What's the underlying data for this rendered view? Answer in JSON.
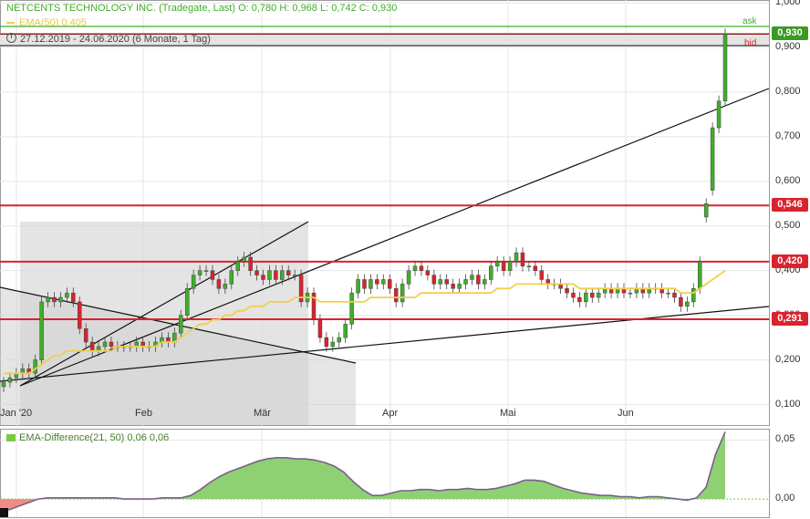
{
  "header": {
    "title": "NETCENTS TECHNOLOGY INC. (Tradegate, Last)  O: 0,780  H: 0,968  L: 0,742  C: 0,930",
    "ema_legend": "EMA(50)  0,405",
    "date_range": "27.12.2019 - 24.06.2020   (6 Monate, 1 Tag)"
  },
  "tags": {
    "ask": "ask",
    "bid": "bid"
  },
  "price_badges": [
    {
      "label": "0,930",
      "value": 0.93,
      "color": "#3a9a23"
    },
    {
      "label": "0,546",
      "value": 0.546,
      "color": "#d9232e"
    },
    {
      "label": "0,420",
      "value": 0.42,
      "color": "#d9232e"
    },
    {
      "label": "0,291",
      "value": 0.291,
      "color": "#d9232e"
    }
  ],
  "colors": {
    "up": "#3fae29",
    "down": "#d9232e",
    "ema": "#f0cf4a",
    "hline": "#d9232e",
    "area": "#8ed172",
    "area_neg": "#f08b86"
  },
  "subpanel": {
    "legend": "EMA-Difference(21, 50)  0,06   0,06"
  },
  "chart_data": [
    {
      "type": "candlestick",
      "title": "NETCENTS TECHNOLOGY INC. (Tradegate, Last)",
      "x_labels": [
        "Jan '20",
        "Feb",
        "Mär",
        "Apr",
        "Mai",
        "Jun"
      ],
      "y_ticks": [
        "1,000",
        "0,900",
        "0,800",
        "0,700",
        "0,600",
        "0,500",
        "0,400",
        "0,300",
        "0,200",
        "0,100"
      ],
      "y_tick_values": [
        1.0,
        0.9,
        0.8,
        0.7,
        0.6,
        0.5,
        0.4,
        0.3,
        0.2,
        0.1
      ],
      "ylim": [
        0.05,
        1.0
      ],
      "grid": true,
      "ohlc_close": [
        0.15,
        0.16,
        0.17,
        0.18,
        0.17,
        0.2,
        0.33,
        0.34,
        0.33,
        0.34,
        0.35,
        0.33,
        0.27,
        0.24,
        0.22,
        0.23,
        0.24,
        0.23,
        0.23,
        0.23,
        0.23,
        0.24,
        0.23,
        0.23,
        0.24,
        0.25,
        0.24,
        0.26,
        0.3,
        0.36,
        0.39,
        0.4,
        0.4,
        0.38,
        0.36,
        0.37,
        0.4,
        0.42,
        0.43,
        0.4,
        0.39,
        0.38,
        0.4,
        0.38,
        0.4,
        0.39,
        0.39,
        0.33,
        0.35,
        0.29,
        0.25,
        0.23,
        0.24,
        0.25,
        0.28,
        0.35,
        0.38,
        0.36,
        0.38,
        0.37,
        0.38,
        0.36,
        0.33,
        0.37,
        0.4,
        0.41,
        0.4,
        0.39,
        0.37,
        0.38,
        0.37,
        0.36,
        0.37,
        0.38,
        0.39,
        0.37,
        0.38,
        0.41,
        0.42,
        0.4,
        0.42,
        0.44,
        0.41,
        0.41,
        0.4,
        0.38,
        0.37,
        0.37,
        0.36,
        0.35,
        0.34,
        0.33,
        0.35,
        0.34,
        0.35,
        0.36,
        0.35,
        0.36,
        0.35,
        0.35,
        0.36,
        0.35,
        0.36,
        0.36,
        0.35,
        0.35,
        0.34,
        0.32,
        0.33,
        0.36,
        0.42,
        0.55,
        0.72,
        0.78,
        0.93
      ],
      "ohlc_open": [
        0.14,
        0.15,
        0.16,
        0.17,
        0.18,
        0.17,
        0.2,
        0.33,
        0.34,
        0.33,
        0.34,
        0.35,
        0.33,
        0.27,
        0.24,
        0.22,
        0.23,
        0.24,
        0.23,
        0.23,
        0.23,
        0.23,
        0.24,
        0.23,
        0.23,
        0.24,
        0.25,
        0.24,
        0.26,
        0.3,
        0.36,
        0.39,
        0.4,
        0.4,
        0.38,
        0.36,
        0.37,
        0.4,
        0.42,
        0.43,
        0.4,
        0.39,
        0.38,
        0.4,
        0.38,
        0.4,
        0.39,
        0.39,
        0.33,
        0.35,
        0.29,
        0.25,
        0.23,
        0.24,
        0.25,
        0.28,
        0.35,
        0.38,
        0.36,
        0.38,
        0.37,
        0.38,
        0.36,
        0.33,
        0.37,
        0.4,
        0.41,
        0.4,
        0.39,
        0.37,
        0.38,
        0.37,
        0.36,
        0.37,
        0.38,
        0.39,
        0.37,
        0.38,
        0.41,
        0.42,
        0.4,
        0.42,
        0.44,
        0.41,
        0.41,
        0.4,
        0.38,
        0.37,
        0.37,
        0.36,
        0.35,
        0.34,
        0.33,
        0.35,
        0.34,
        0.35,
        0.36,
        0.35,
        0.36,
        0.35,
        0.35,
        0.36,
        0.35,
        0.36,
        0.36,
        0.35,
        0.35,
        0.34,
        0.32,
        0.33,
        0.36,
        0.52,
        0.58,
        0.72,
        0.78
      ],
      "ema50": [
        0.17,
        0.17,
        0.17,
        0.17,
        0.17,
        0.18,
        0.19,
        0.2,
        0.21,
        0.21,
        0.22,
        0.22,
        0.22,
        0.22,
        0.22,
        0.22,
        0.22,
        0.22,
        0.23,
        0.23,
        0.23,
        0.23,
        0.23,
        0.23,
        0.23,
        0.24,
        0.24,
        0.24,
        0.25,
        0.26,
        0.27,
        0.28,
        0.28,
        0.29,
        0.29,
        0.3,
        0.3,
        0.31,
        0.31,
        0.32,
        0.32,
        0.32,
        0.33,
        0.33,
        0.33,
        0.33,
        0.34,
        0.34,
        0.34,
        0.34,
        0.33,
        0.33,
        0.33,
        0.33,
        0.33,
        0.33,
        0.33,
        0.33,
        0.34,
        0.34,
        0.34,
        0.34,
        0.34,
        0.34,
        0.34,
        0.34,
        0.35,
        0.35,
        0.35,
        0.35,
        0.35,
        0.35,
        0.35,
        0.35,
        0.35,
        0.35,
        0.35,
        0.35,
        0.36,
        0.36,
        0.36,
        0.37,
        0.37,
        0.37,
        0.37,
        0.37,
        0.37,
        0.37,
        0.37,
        0.37,
        0.37,
        0.36,
        0.36,
        0.36,
        0.36,
        0.36,
        0.36,
        0.36,
        0.36,
        0.36,
        0.36,
        0.36,
        0.36,
        0.36,
        0.36,
        0.36,
        0.36,
        0.35,
        0.35,
        0.35,
        0.36,
        0.37,
        0.38,
        0.39,
        0.4
      ],
      "horizontal_lines": [
        0.93,
        0.546,
        0.42,
        0.291
      ]
    },
    {
      "type": "area",
      "title": "EMA-Difference(21, 50)",
      "y_ticks": [
        "0,05",
        "0,00"
      ],
      "y_tick_values": [
        0.05,
        0.0
      ],
      "ylim": [
        -0.01,
        0.055
      ],
      "values": [
        -0.01,
        -0.009,
        -0.006,
        -0.003,
        0.0,
        0.001,
        0.001,
        0.001,
        0.001,
        0.001,
        0.001,
        0.001,
        0.001,
        0.0,
        0.0,
        0.0,
        0.0,
        0.001,
        0.001,
        0.001,
        0.003,
        0.008,
        0.014,
        0.019,
        0.023,
        0.026,
        0.029,
        0.032,
        0.034,
        0.035,
        0.035,
        0.034,
        0.034,
        0.033,
        0.031,
        0.028,
        0.023,
        0.015,
        0.008,
        0.003,
        0.003,
        0.005,
        0.007,
        0.007,
        0.008,
        0.008,
        0.007,
        0.008,
        0.008,
        0.009,
        0.008,
        0.008,
        0.009,
        0.011,
        0.013,
        0.016,
        0.016,
        0.015,
        0.012,
        0.009,
        0.007,
        0.005,
        0.004,
        0.003,
        0.003,
        0.002,
        0.002,
        0.001,
        0.002,
        0.002,
        0.001,
        0.0,
        -0.001,
        0.001,
        0.01,
        0.038,
        0.057
      ]
    }
  ]
}
